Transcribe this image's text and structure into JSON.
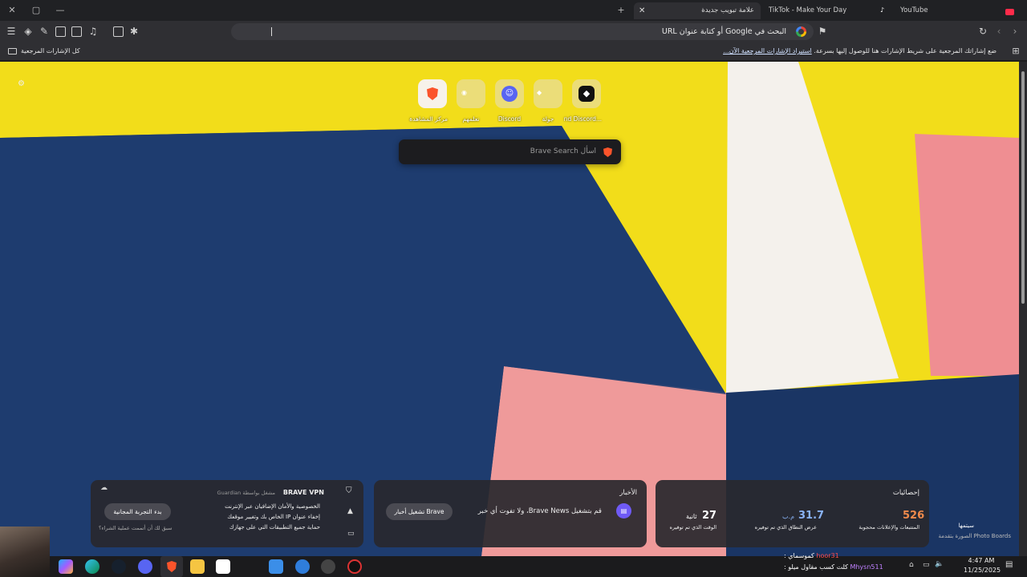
{
  "colors": {
    "brave_orange": "#fb542b",
    "discord": "#5865f2",
    "yellow": "#f2dd1a",
    "navy": "#1d3a6a",
    "pink": "#ef9a9a",
    "white_panel": "#f4f1ec",
    "stats_orange": "#f08a4b",
    "stats_blue": "#8ab4f8"
  },
  "tabs": [
    {
      "title": "علامة تبويب جديدة",
      "icon": "brave-icon",
      "active": true
    },
    {
      "title": "TikTok - Make Your Day",
      "icon": "tiktok-icon",
      "active": false
    },
    {
      "title": "YouTube",
      "icon": "youtube-icon",
      "active": false
    }
  ],
  "toolbar": {
    "omnibox_placeholder": "البحث في Google أو كتابة عنوان URL",
    "shields_badge": "2"
  },
  "bookmarks": {
    "hint": "ضع إشاراتك المرجعية على شريط الإشارات هنا للوصول إليها بسرعة.",
    "import_link": "استيراد الإشارات المرجعية الآن...",
    "all_bookmarks": "كل الإشارات المرجعية"
  },
  "top_sites": [
    {
      "label": "مركز المشاهدة",
      "icon": "brave-icon"
    },
    {
      "label": "تعلمهم",
      "icon": "learn-icon"
    },
    {
      "label": "Discord",
      "icon": "discord-icon"
    },
    {
      "label": "جولة",
      "icon": "tour-icon"
    },
    {
      "label": "...nd Discord",
      "icon": "app-icon"
    }
  ],
  "search": {
    "placeholder": "اسأل Brave Search"
  },
  "vpn_card": {
    "title": "BRAVE VPN",
    "powered": "مشغل بواسطة Guardian",
    "features": [
      "الخصوصية والأمان الإضافيان عبر الإنترنت",
      "إخفاء عنوان IP الخاص بك وتغيير موقعك",
      "حماية جميع التطبيقات التي على جهازك"
    ],
    "trial_button": "بدء التجربة المجانية",
    "restore_link": "سبق لك أن أتممت عملية الشراء؟"
  },
  "news_card": {
    "title": "الأخبار",
    "message": "قم بتشغيل Brave News، ولا تفوت أي خبر",
    "button": "تشغيل أخبار Brave"
  },
  "stats_card": {
    "title": "إحصائيات",
    "items": [
      {
        "value": "526",
        "label": "المتتبعات والإعلانات محجوبة"
      },
      {
        "value": "31.7",
        "unit": "م.ب",
        "label": "عرض النطاق الذي تم توفيره"
      },
      {
        "value": "27",
        "unit": "ثانية",
        "label": "الوقت الذي تم توفيره"
      }
    ]
  },
  "photo_credit": {
    "line1": "سيتمها",
    "line2": "الصورة بتقدمة Photo Boards"
  },
  "chat_overlay": [
    {
      "user": "hoor31",
      "message": "كموسماي :"
    },
    {
      "user": "Mhysn511",
      "message": "كلت كسب مقاول ميلو :"
    }
  ],
  "taskbar": {
    "time": "4:47 AM",
    "date": "11/25/2025"
  }
}
